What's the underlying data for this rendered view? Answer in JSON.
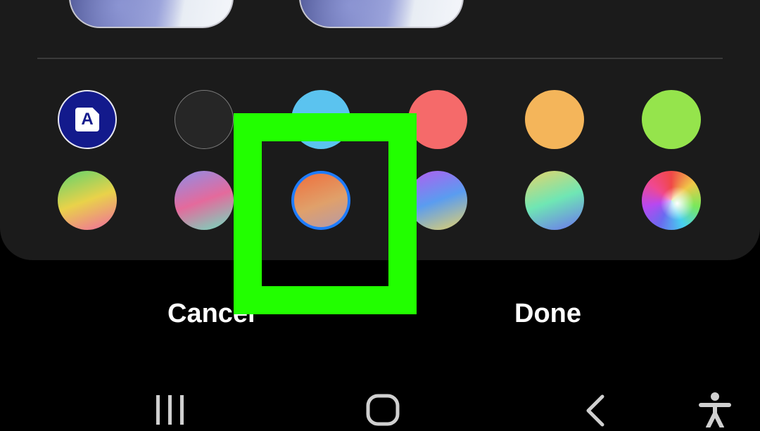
{
  "dialog": {
    "cancel_label": "Cancel",
    "done_label": "Done"
  },
  "palette": {
    "rows": [
      [
        {
          "name": "theme-color-swatch",
          "glyph": "A",
          "colors": [
            "#131a8c"
          ]
        },
        {
          "name": "black-swatch",
          "colors": [
            "#262626"
          ]
        },
        {
          "name": "sky-blue-swatch",
          "colors": [
            "#5bc3ef"
          ]
        },
        {
          "name": "coral-red-swatch",
          "colors": [
            "#f56a6a"
          ]
        },
        {
          "name": "orange-swatch",
          "colors": [
            "#f4b55a"
          ]
        },
        {
          "name": "lime-green-swatch",
          "colors": [
            "#95e44c"
          ]
        }
      ],
      [
        {
          "name": "green-yellow-pink-gradient-swatch",
          "colors": [
            "#5fd36d",
            "#e9d24a",
            "#f06aa0"
          ]
        },
        {
          "name": "blue-pink-teal-gradient-swatch",
          "colors": [
            "#8e8ee8",
            "#e46a9c",
            "#6ee0c0"
          ]
        },
        {
          "name": "orange-gradient-swatch",
          "selected": true,
          "colors": [
            "#ef6f3c",
            "#e0a06a",
            "#b79aa6"
          ]
        },
        {
          "name": "purple-blue-yellow-gradient-swatch",
          "colors": [
            "#b45cf0",
            "#5a9cf0",
            "#e6d26a"
          ]
        },
        {
          "name": "yellow-green-blue-gradient-swatch",
          "colors": [
            "#e6d46a",
            "#6fe6b4",
            "#6c74f0"
          ]
        },
        {
          "name": "rainbow-spectrum-swatch",
          "colors": [
            "#f04848",
            "#f0c848",
            "#48d0f0",
            "#b848f0"
          ]
        }
      ]
    ]
  },
  "nav": {
    "icons": [
      "recent-apps-icon",
      "home-icon",
      "back-icon",
      "accessibility-icon"
    ],
    "color": "#d0d0d0"
  },
  "highlight_color": "#22ff00",
  "selection_color": "#1e7cff"
}
